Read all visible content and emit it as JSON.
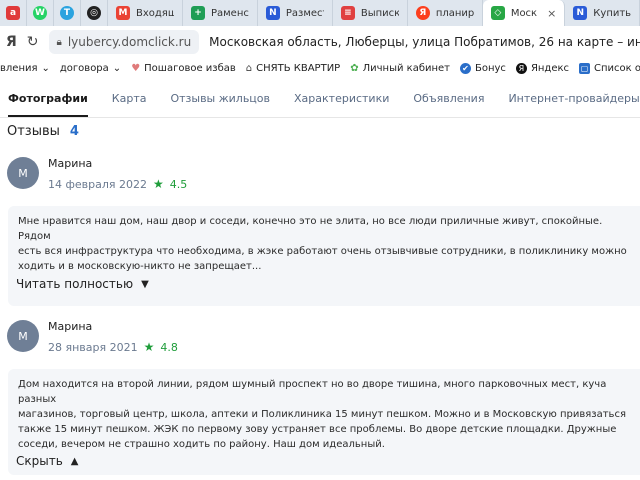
{
  "tabs": [
    {
      "label": "",
      "favicon": "a",
      "color": "#e03a3a"
    },
    {
      "label": "",
      "favicon": "W",
      "color": "#25d366"
    },
    {
      "label": "",
      "favicon": "T",
      "color": "#2aa3df"
    },
    {
      "label": "",
      "favicon": "◎",
      "color": "#222222"
    },
    {
      "label": "Входящ",
      "favicon": "M",
      "color": "#ea4335"
    },
    {
      "label": "Раменс",
      "favicon": "+",
      "color": "#1f9d55"
    },
    {
      "label": "Размест",
      "favicon": "N",
      "color": "#2a5bd7"
    },
    {
      "label": "Выписк",
      "favicon": "≡",
      "color": "#e04040"
    },
    {
      "label": "планир",
      "favicon": "Я",
      "color": "#fc3f1d"
    },
    {
      "label": "Моск",
      "favicon": "◇",
      "color": "#28a745",
      "active": true,
      "close": "×"
    },
    {
      "label": "Купить",
      "favicon": "N",
      "color": "#2a5bd7"
    }
  ],
  "address": {
    "host": "lyubercy.domclick.ru",
    "title": "Московская область, Люберцы, улица Побратимов, 26 на карте – инф"
  },
  "bookmarks": [
    {
      "label": "вления",
      "dropdown": true
    },
    {
      "label": "договора",
      "dropdown": true
    },
    {
      "label": "Пошаговое избав",
      "icon": "♥",
      "color": "#e07b7b"
    },
    {
      "label": "СНЯТЬ КВАРТИР",
      "icon": "⌂",
      "color": "#444444"
    },
    {
      "label": "Личный кабинет",
      "icon": "✿",
      "color": "#4caf50"
    },
    {
      "label": "Бонус",
      "icon": "✔",
      "color": "#2a6ec9"
    },
    {
      "label": "Яндекс",
      "icon": "Я",
      "color": "#111111"
    },
    {
      "label": "Список о",
      "icon": "▢",
      "color": "#2a6ec9"
    }
  ],
  "page_nav": [
    {
      "label": "Фотографии",
      "active": true
    },
    {
      "label": "Карта"
    },
    {
      "label": "Отзывы жильцов"
    },
    {
      "label": "Характеристики"
    },
    {
      "label": "Объявления"
    },
    {
      "label": "Интернет-провайдеры"
    }
  ],
  "reviews": {
    "title": "Отзывы",
    "count": "4",
    "items": [
      {
        "initial": "М",
        "author": "Марина",
        "date": "14 февраля 2022",
        "rating": "4.5",
        "text": "Мне нравится наш дом, наш двор и соседи, конечно это не элита, но все люди приличные живут, спокойные. Рядом\nесть вся инфраструктура что необходима, в жэке работают очень отзывчивые сотрудники, в поликлинику можно\nходить и в московскую-никто не запрещает...",
        "toggle": "Читать полностью",
        "toggle_icon": "chevron-down"
      },
      {
        "initial": "М",
        "author": "Марина",
        "date": "28 января 2021",
        "rating": "4.8",
        "text": "Дом находится на второй линии, рядом шумный проспект но во дворе тишина, много парковочных мест, куча разных\nмагазинов, торговый центр, школа, аптеки и Поликлиника 15 минут пешком. Можно и в Московскую привязаться\nтакже 15 минут пешком. ЖЭК по первому зову устраняет все проблемы. Во дворе детские площадки. Дружные\nсоседи, вечером не страшно ходить по району. Наш дом идеальный.",
        "toggle": "Скрыть",
        "toggle_icon": "chevron-up"
      }
    ]
  }
}
